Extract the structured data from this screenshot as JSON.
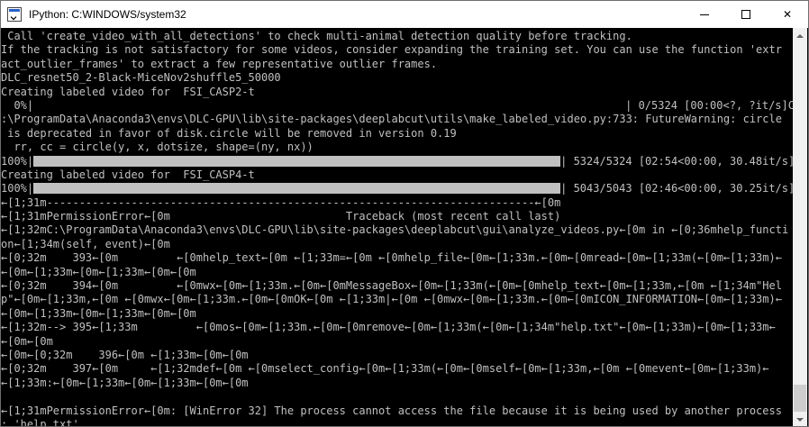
{
  "window": {
    "title": "IPython: C:WINDOWS/system32",
    "minimize_label": "",
    "maximize_label": "",
    "close_label": "✕"
  },
  "console": {
    "lines": [
      " Call 'create_video_with_all_detections' to check multi-animal detection quality before tracking.",
      "If the tracking is not satisfactory for some videos, consider expanding the training set. You can use the function 'extr",
      "act_outlier_frames' to extract a few representative outlier frames.",
      "DLC_resnet50_2-Black-MiceNov2shuffle5_50000",
      "Creating labeled video for  FSI_CASP2-t",
      "  0%|",
      ":\\ProgramData\\Anaconda3\\envs\\DLC-GPU\\lib\\site-packages\\deeplabcut\\utils\\make_labeled_video.py:733: FutureWarning: circle",
      " is deprecated in favor of disk.circle will be removed in version 0.19",
      "  rr, cc = circle(y, x, dotsize, shape=(ny, nx))",
      "100%|",
      "Creating labeled video for  FSI_CASP4-t",
      "100%|",
      "←[1;31m---------------------------------------------------------------------------←[0m",
      "←[1;31mPermissionError←[0m                           Traceback (most recent call last)",
      "←[1;32mC:\\ProgramData\\Anaconda3\\envs\\DLC-GPU\\lib\\site-packages\\deeplabcut\\gui\\analyze_videos.py←[0m in ←[0;36mhelp_functi",
      "on←[1;34m(self, event)←[0m",
      "←[0;32m    393←[0m         ←[0mhelp_text←[0m ←[1;33m=←[0m ←[0mhelp_file←[0m←[1;33m.←[0m←[0mread←[0m←[1;33m(←[0m←[1;33m)←",
      "←[0m←[1;33m←[0m←[1;33m←[0m←[0m",
      "←[0;32m    394←[0m         ←[0mwx←[0m←[1;33m.←[0m←[0mMessageBox←[0m←[1;33m(←[0m←[0mhelp_text←[0m←[1;33m,←[0m ←[1;34m\"Hel",
      "p\"←[0m←[1;33m,←[0m ←[0mwx←[0m←[1;33m.←[0m←[0mOK←[0m ←[1;33m|←[0m ←[0mwx←[0m←[1;33m.←[0m←[0mICON_INFORMATION←[0m←[1;33m)←",
      "←[0m←[1;33m←[0m←[1;33m←[0m←[0m",
      "←[1;32m--> 395←[1;33m         ←[0mos←[0m←[1;33m.←[0m←[0mremove←[0m←[1;33m(←[0m←[1;34m\"help.txt\"←[0m←[1;33m)←[0m←[1;33m←",
      "←[0m←[0m",
      "←[0m←[0;32m    396←[0m ←[1;33m←[0m←[0m",
      "←[0;32m    397←[0m     ←[1;32mdef←[0m ←[0mselect_config←[0m←[1;33m(←[0m←[0mself←[0m←[1;33m,←[0m ←[0mevent←[0m←[1;33m)←",
      "←[1;33m:←[0m←[1;33m←[0m←[1;33m←[0m←[0m",
      "",
      "←[1;31mPermissionError←[0m: [WinError 32] The process cannot access the file because it is being used by another process",
      ": 'help.txt'"
    ],
    "progress": [
      {
        "line_index": 5,
        "percent": 0,
        "status": "| 0/5324 [00:00<?, ?it/s]C"
      },
      {
        "line_index": 9,
        "percent": 100,
        "status": "| 5324/5324 [02:54<00:00, 30.48it/s]"
      },
      {
        "line_index": 11,
        "percent": 100,
        "status": "| 5043/5043 [02:46<00:00, 30.25it/s]"
      }
    ]
  },
  "colors": {
    "console_bg": "#000000",
    "console_fg": "#c0c0c0",
    "titlebar_bg": "#ffffff"
  }
}
